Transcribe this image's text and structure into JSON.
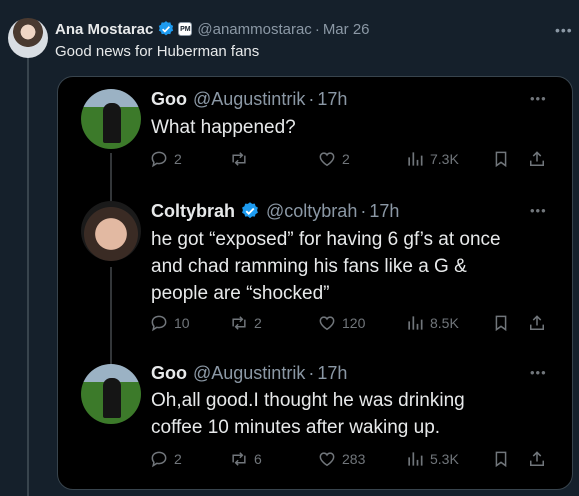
{
  "main": {
    "author": "Ana Mostarac",
    "affiliate_badge": "PM",
    "handle": "@anammostarac",
    "date": "Mar 26",
    "text": "Good news for Huberman fans",
    "more_icon": "more-icon"
  },
  "replies": [
    {
      "name": "Goo",
      "handle": "@Augustintrik",
      "time": "17h",
      "verified": false,
      "text": "What happened?",
      "replies": "2",
      "retweets": "",
      "likes": "2",
      "views": "7.3K"
    },
    {
      "name": "Coltybrah",
      "handle": "@coltybrah",
      "time": "17h",
      "verified": true,
      "text": "he got “exposed” for having 6 gf’s at once\nand chad ramming his fans like a G &\npeople are “shocked”",
      "replies": "10",
      "retweets": "2",
      "likes": "120",
      "views": "8.5K"
    },
    {
      "name": "Goo",
      "handle": "@Augustintrik",
      "time": "17h",
      "verified": false,
      "text": "Oh,all good.I thought he was drinking\ncoffee 10 minutes after waking up.",
      "replies": "2",
      "retweets": "6",
      "likes": "283",
      "views": "5.3K"
    }
  ],
  "colors": {
    "background": "#15202b",
    "card": "#000000",
    "verified": "#1d9bf0",
    "muted": "#8b98a5"
  }
}
